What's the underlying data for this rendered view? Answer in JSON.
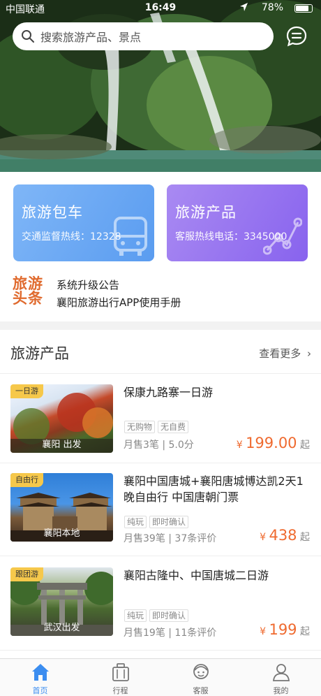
{
  "status_bar": {
    "carrier": "中国联通",
    "time": "16:49",
    "battery": "78%"
  },
  "search": {
    "placeholder": "搜索旅游产品、景点"
  },
  "cards": [
    {
      "title": "旅游包车",
      "subtitle": "交通监督热线：12328"
    },
    {
      "title": "旅游产品",
      "subtitle": "客服热线电话：3345000"
    }
  ],
  "news": {
    "logo": "旅游头条",
    "items": [
      "系统升级公告",
      "襄阳旅游出行APP使用手册"
    ]
  },
  "section": {
    "title": "旅游产品",
    "more": "查看更多"
  },
  "products": [
    {
      "tag": "一日游",
      "caption": "襄阳 出发",
      "title": "保康九路寨一日游",
      "chips": [
        "无购物",
        "无自费"
      ],
      "meta": "月售3笔 | 5.0分",
      "currency": "¥",
      "price": "199.00",
      "suffix": "起"
    },
    {
      "tag": "自由行",
      "caption": "襄阳本地",
      "title": "襄阳中国唐城+襄阳唐城博达凯2天1晚自由行 中国唐朝门票",
      "chips": [
        "纯玩",
        "即时确认"
      ],
      "meta": "月售39笔 | 37条评价",
      "currency": "¥",
      "price": "438",
      "suffix": "起"
    },
    {
      "tag": "跟团游",
      "caption": "武汉出发",
      "title": "襄阳古隆中、中国唐城二日游",
      "chips": [
        "纯玩",
        "即时确认"
      ],
      "meta": "月售19笔 | 11条评价",
      "currency": "¥",
      "price": "199",
      "suffix": "起"
    }
  ],
  "tabs": [
    {
      "label": "首页",
      "icon": "home-icon",
      "active": true
    },
    {
      "label": "行程",
      "icon": "suitcase-icon",
      "active": false
    },
    {
      "label": "客服",
      "icon": "service-icon",
      "active": false
    },
    {
      "label": "我的",
      "icon": "user-icon",
      "active": false
    }
  ],
  "colors": {
    "accent": "#3b8df0",
    "price": "#ef6a2f",
    "tag": "#f6c84b",
    "news_logo": "#e06b2f"
  }
}
